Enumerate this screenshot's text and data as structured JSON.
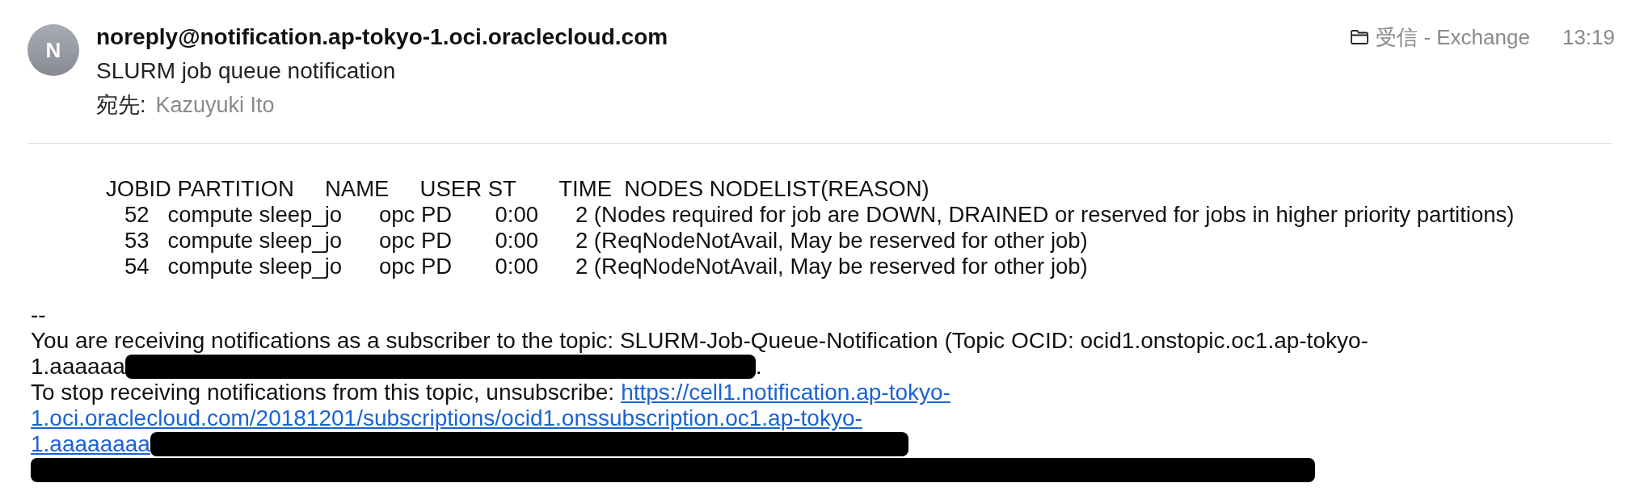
{
  "header": {
    "avatar_initial": "N",
    "sender": "noreply@notification.ap-tokyo-1.oci.oraclecloud.com",
    "subject": "SLURM job queue notification",
    "to_label": "宛先:",
    "to_name": "Kazuyuki Ito",
    "folder": "受信 - Exchange",
    "time": "13:19"
  },
  "squeue_output": {
    "lines": [
      "JOBID PARTITION     NAME     USER ST       TIME  NODES NODELIST(REASON)",
      "52   compute sleep_jo      opc PD       0:00      2 (Nodes required for job are DOWN, DRAINED or reserved for jobs in higher priority partitions)",
      "53   compute sleep_jo      opc PD       0:00      2 (ReqNodeNotAvail, May be reserved for other job)",
      "54   compute sleep_jo      opc PD       0:00      2 (ReqNodeNotAvail, May be reserved for other job)"
    ]
  },
  "footer": {
    "separator": "--",
    "topic_text": "You are receiving notifications as a subscriber to the topic: SLURM-Job-Queue-Notification (Topic OCID: ocid1.onstopic.oc1.ap-tokyo-",
    "topic_cont": "1.aaaaaa",
    "topic_end": ".",
    "unsubscribe_text": "To stop receiving notifications from this topic, unsubscribe:",
    "unsubscribe_link": [
      "https://cell1.notification.ap-tokyo-",
      "1.oci.oraclecloud.com/20181201/subscriptions/ocid1.onssubscription.oc1.ap-tokyo-",
      "1.aaaaaaaa"
    ]
  }
}
